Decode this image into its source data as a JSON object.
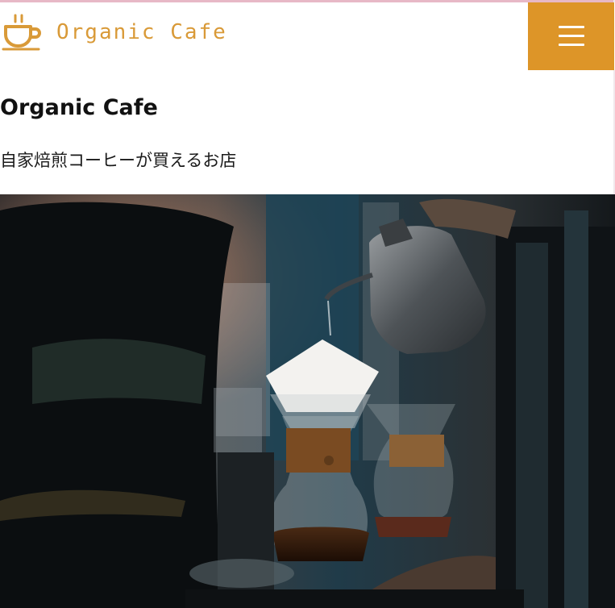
{
  "header": {
    "logo": {
      "icon": "coffee-cup-icon",
      "text": "Organic Cafe"
    },
    "menu_button": {
      "icon": "hamburger-menu-icon"
    }
  },
  "hero": {
    "title": "Organic Cafe",
    "subtitle": "自家焙煎コーヒーが買えるお店"
  },
  "colors": {
    "accent": "#dd9528",
    "logo_text": "#d99a38",
    "heading": "#111111",
    "background": "#ffffff"
  }
}
